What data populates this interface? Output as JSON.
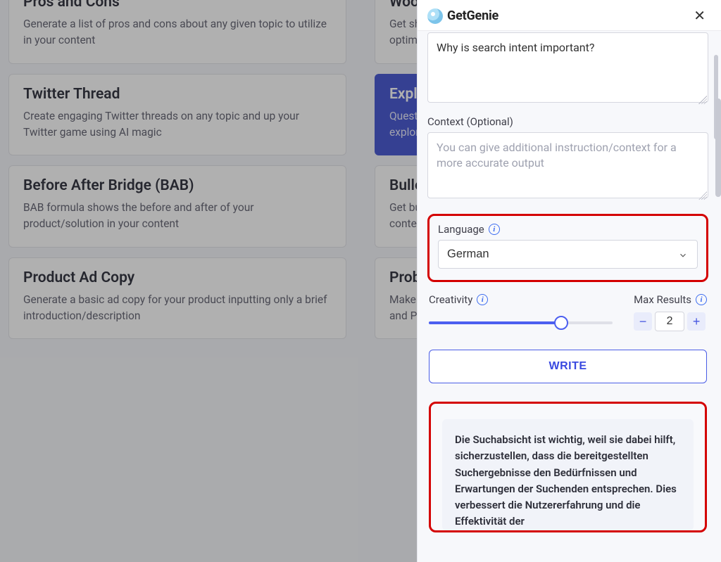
{
  "grid": [
    {
      "title": "Pros and Cons",
      "desc": "Generate a list of pros and cons about any given topic to utilize in your content",
      "active": false
    },
    {
      "title": "WooCommerce Product Short Description",
      "desc": "Get short descriptions for your WooCommerce products optimized for conversions",
      "active": false
    },
    {
      "title": "Twitter Thread",
      "desc": "Create engaging Twitter threads on any topic and up your Twitter game using AI magic",
      "active": false
    },
    {
      "title": "Explain Like a Kid",
      "desc": "Questions made simple enough for a five-year-old — let's explore together!",
      "active": true
    },
    {
      "title": "Before After Bridge (BAB)",
      "desc": "BAB formula shows the before and after of your product/solution in your content",
      "active": false
    },
    {
      "title": "Bullet Points",
      "desc": "Get bulleted lists of key points to use when writing long-form content",
      "active": false
    },
    {
      "title": "Product Ad Copy",
      "desc": "Generate a basic ad copy for your product inputting only a brief introduction/description",
      "active": false
    },
    {
      "title": "Problem Agitate Solve (PAS)",
      "desc": "Make use of the classic copywriting framework Agitate, Solve, and Problem",
      "active": false
    }
  ],
  "brand": "GetGenie",
  "panel": {
    "topic_value": "Why is search intent important?",
    "context_label": "Context (Optional)",
    "context_placeholder": "You can give additional instruction/context for a more accurate output",
    "language_label": "Language",
    "language_value": "German",
    "creativity_label": "Creativity",
    "creativity_percent": 72,
    "maxresults_label": "Max Results",
    "maxresults_value": "2",
    "write_label": "WRITE",
    "result_text": "Die Suchabsicht ist wichtig, weil sie dabei hilft, sicherzustellen, dass die bereitgestellten Suchergebnisse den Bedürfnissen und Erwartungen der Suchenden entsprechen. Dies verbessert die Nutzererfahrung und die Effektivität der"
  }
}
